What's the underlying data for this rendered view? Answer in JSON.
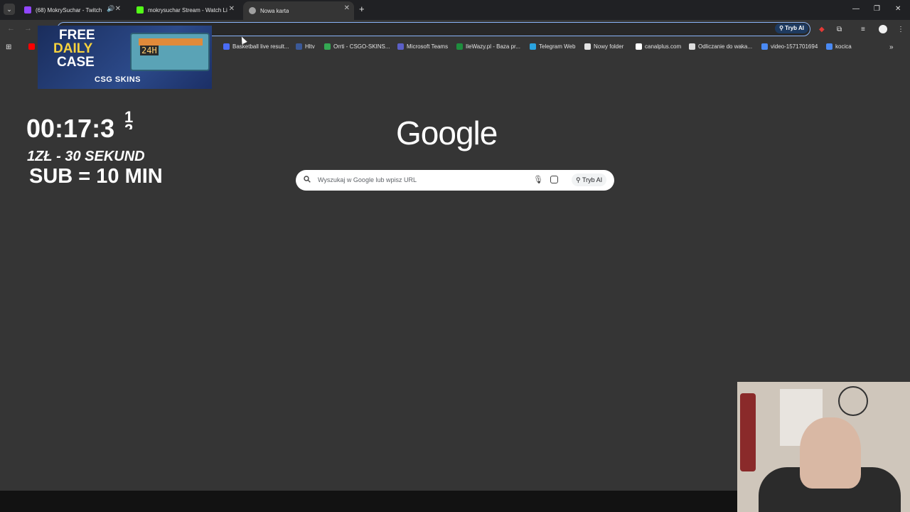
{
  "tabs": [
    {
      "title": "(68) MokrySuchar - Twitch",
      "favicon_color": "#9146ff"
    },
    {
      "title": "mokrysuchar Stream - Watch Li",
      "favicon_color": "#53fc18"
    },
    {
      "title": "Nowa karta",
      "favicon_color": "#a0a0a0"
    }
  ],
  "toolbar": {
    "ai_mode_label": "Tryb AI"
  },
  "bookmarks": [
    {
      "label": "Basketball live result...",
      "color": "#4a6cf7"
    },
    {
      "label": "Hltv",
      "color": "#3b5998"
    },
    {
      "label": "Orrti - CSGO-SKINS...",
      "color": "#34a853"
    },
    {
      "label": "Microsoft Teams",
      "color": "#5b5fc7"
    },
    {
      "label": "IleWazy.pl - Baza pr...",
      "color": "#1e8e3e"
    },
    {
      "label": "Telegram Web",
      "color": "#2aa3df"
    },
    {
      "label": "Nowy folder",
      "color": "#e3e3e3"
    },
    {
      "label": "canalplus.com",
      "color": "#ffffff"
    },
    {
      "label": "Odliczanie do waka...",
      "color": "#dddddd"
    },
    {
      "label": "video-1571701694",
      "color": "#4a8af4"
    },
    {
      "label": "kocica",
      "color": "#4a8af4"
    }
  ],
  "google": {
    "logo": "Google",
    "search_placeholder": "Wyszukaj w Google lub wpisz URL",
    "ai_mode_label": "Tryb AI"
  },
  "overlay": {
    "case_free": "FREE",
    "case_daily": "DAILY",
    "case_case": "CASE",
    "case_timer": "24H",
    "case_brand": "CSG SKINS",
    "timer": "00:17:3",
    "timer_digit_top": "1",
    "timer_digit_bottom": "2",
    "rate": "1ZŁ - 30 SEKUND",
    "sub": "SUB = 10 MIN"
  }
}
